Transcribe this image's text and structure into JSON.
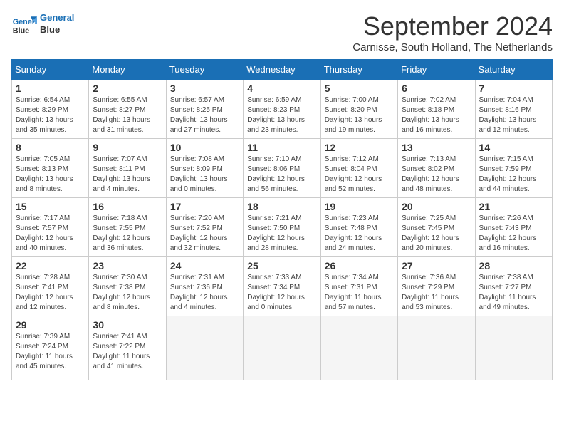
{
  "logo": {
    "line1": "General",
    "line2": "Blue"
  },
  "title": "September 2024",
  "subtitle": "Carnisse, South Holland, The Netherlands",
  "days_of_week": [
    "Sunday",
    "Monday",
    "Tuesday",
    "Wednesday",
    "Thursday",
    "Friday",
    "Saturday"
  ],
  "weeks": [
    [
      {
        "day": "1",
        "info": "Sunrise: 6:54 AM\nSunset: 8:29 PM\nDaylight: 13 hours\nand 35 minutes."
      },
      {
        "day": "2",
        "info": "Sunrise: 6:55 AM\nSunset: 8:27 PM\nDaylight: 13 hours\nand 31 minutes."
      },
      {
        "day": "3",
        "info": "Sunrise: 6:57 AM\nSunset: 8:25 PM\nDaylight: 13 hours\nand 27 minutes."
      },
      {
        "day": "4",
        "info": "Sunrise: 6:59 AM\nSunset: 8:23 PM\nDaylight: 13 hours\nand 23 minutes."
      },
      {
        "day": "5",
        "info": "Sunrise: 7:00 AM\nSunset: 8:20 PM\nDaylight: 13 hours\nand 19 minutes."
      },
      {
        "day": "6",
        "info": "Sunrise: 7:02 AM\nSunset: 8:18 PM\nDaylight: 13 hours\nand 16 minutes."
      },
      {
        "day": "7",
        "info": "Sunrise: 7:04 AM\nSunset: 8:16 PM\nDaylight: 13 hours\nand 12 minutes."
      }
    ],
    [
      {
        "day": "8",
        "info": "Sunrise: 7:05 AM\nSunset: 8:13 PM\nDaylight: 13 hours\nand 8 minutes."
      },
      {
        "day": "9",
        "info": "Sunrise: 7:07 AM\nSunset: 8:11 PM\nDaylight: 13 hours\nand 4 minutes."
      },
      {
        "day": "10",
        "info": "Sunrise: 7:08 AM\nSunset: 8:09 PM\nDaylight: 13 hours\nand 0 minutes."
      },
      {
        "day": "11",
        "info": "Sunrise: 7:10 AM\nSunset: 8:06 PM\nDaylight: 12 hours\nand 56 minutes."
      },
      {
        "day": "12",
        "info": "Sunrise: 7:12 AM\nSunset: 8:04 PM\nDaylight: 12 hours\nand 52 minutes."
      },
      {
        "day": "13",
        "info": "Sunrise: 7:13 AM\nSunset: 8:02 PM\nDaylight: 12 hours\nand 48 minutes."
      },
      {
        "day": "14",
        "info": "Sunrise: 7:15 AM\nSunset: 7:59 PM\nDaylight: 12 hours\nand 44 minutes."
      }
    ],
    [
      {
        "day": "15",
        "info": "Sunrise: 7:17 AM\nSunset: 7:57 PM\nDaylight: 12 hours\nand 40 minutes."
      },
      {
        "day": "16",
        "info": "Sunrise: 7:18 AM\nSunset: 7:55 PM\nDaylight: 12 hours\nand 36 minutes."
      },
      {
        "day": "17",
        "info": "Sunrise: 7:20 AM\nSunset: 7:52 PM\nDaylight: 12 hours\nand 32 minutes."
      },
      {
        "day": "18",
        "info": "Sunrise: 7:21 AM\nSunset: 7:50 PM\nDaylight: 12 hours\nand 28 minutes."
      },
      {
        "day": "19",
        "info": "Sunrise: 7:23 AM\nSunset: 7:48 PM\nDaylight: 12 hours\nand 24 minutes."
      },
      {
        "day": "20",
        "info": "Sunrise: 7:25 AM\nSunset: 7:45 PM\nDaylight: 12 hours\nand 20 minutes."
      },
      {
        "day": "21",
        "info": "Sunrise: 7:26 AM\nSunset: 7:43 PM\nDaylight: 12 hours\nand 16 minutes."
      }
    ],
    [
      {
        "day": "22",
        "info": "Sunrise: 7:28 AM\nSunset: 7:41 PM\nDaylight: 12 hours\nand 12 minutes."
      },
      {
        "day": "23",
        "info": "Sunrise: 7:30 AM\nSunset: 7:38 PM\nDaylight: 12 hours\nand 8 minutes."
      },
      {
        "day": "24",
        "info": "Sunrise: 7:31 AM\nSunset: 7:36 PM\nDaylight: 12 hours\nand 4 minutes."
      },
      {
        "day": "25",
        "info": "Sunrise: 7:33 AM\nSunset: 7:34 PM\nDaylight: 12 hours\nand 0 minutes."
      },
      {
        "day": "26",
        "info": "Sunrise: 7:34 AM\nSunset: 7:31 PM\nDaylight: 11 hours\nand 57 minutes."
      },
      {
        "day": "27",
        "info": "Sunrise: 7:36 AM\nSunset: 7:29 PM\nDaylight: 11 hours\nand 53 minutes."
      },
      {
        "day": "28",
        "info": "Sunrise: 7:38 AM\nSunset: 7:27 PM\nDaylight: 11 hours\nand 49 minutes."
      }
    ],
    [
      {
        "day": "29",
        "info": "Sunrise: 7:39 AM\nSunset: 7:24 PM\nDaylight: 11 hours\nand 45 minutes."
      },
      {
        "day": "30",
        "info": "Sunrise: 7:41 AM\nSunset: 7:22 PM\nDaylight: 11 hours\nand 41 minutes."
      },
      {
        "day": "",
        "info": ""
      },
      {
        "day": "",
        "info": ""
      },
      {
        "day": "",
        "info": ""
      },
      {
        "day": "",
        "info": ""
      },
      {
        "day": "",
        "info": ""
      }
    ]
  ]
}
